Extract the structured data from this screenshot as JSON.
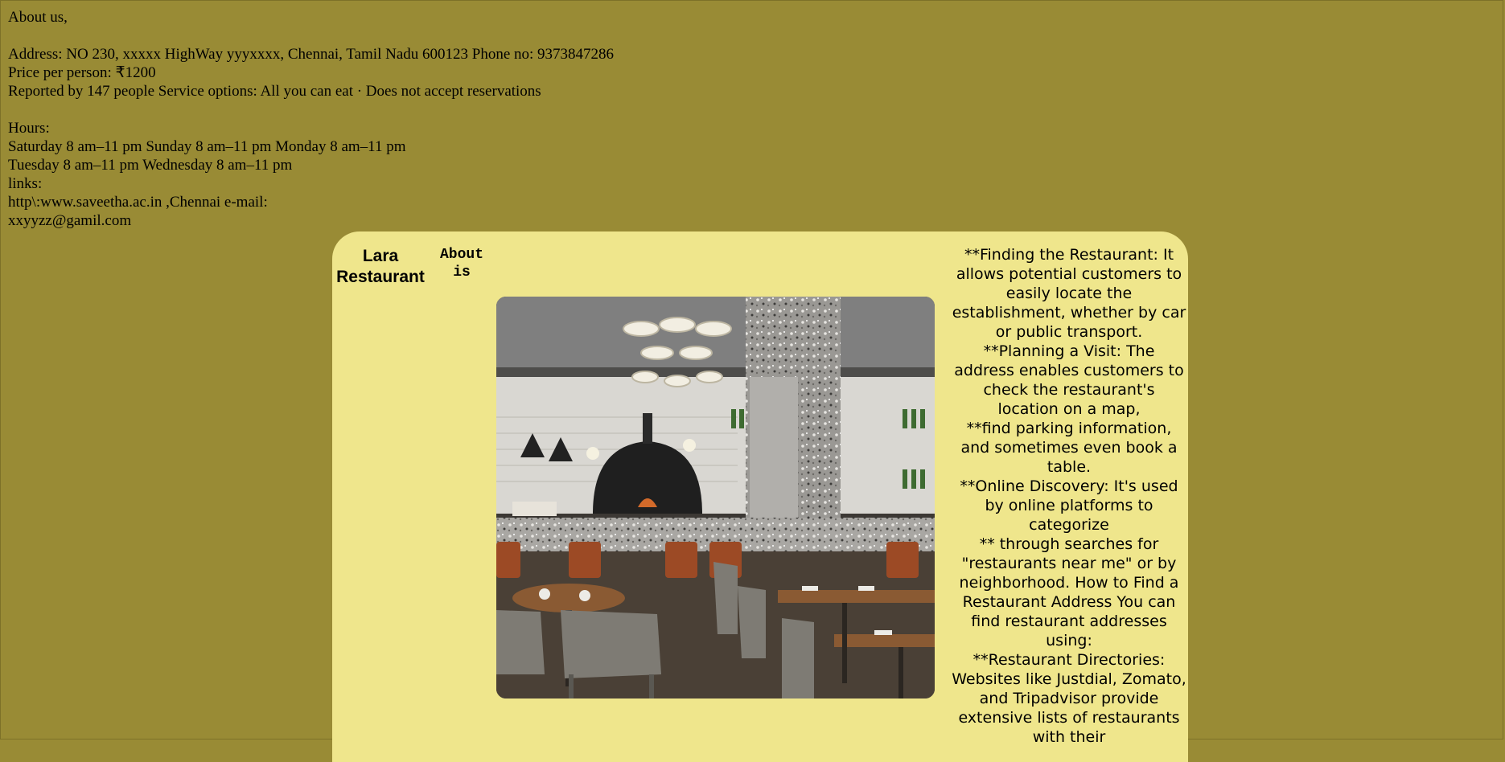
{
  "about": {
    "heading": "About us,",
    "address_line": "Address: NO 230, xxxxx HighWay yyyxxxx, Chennai, Tamil Nadu 600123 Phone no: 9373847286",
    "price_line": "Price per person: ₹1200",
    "service_line": "Reported by 147 people Service options: All you can eat · Does not accept reservations",
    "hours_label": "Hours:",
    "hours_line_1": "Saturday 8 am–11 pm Sunday 8 am–11 pm Monday 8 am–11 pm",
    "hours_line_2": "Tuesday 8 am–11 pm Wednesday 8 am–11 pm",
    "links_label": "links:",
    "links_line": "http\\:www.saveetha.ac.in ,Chennai e-mail:",
    "email": "xxyyzz@gamil.com"
  },
  "panel": {
    "brand_line_1": "Lara",
    "brand_line_2": "Restaurant",
    "about_line_1": "About",
    "about_line_2": "is",
    "photo_icon": "restaurant-interior-photo",
    "description": [
      "**Finding the Restaurant: It allows potential customers to easily locate the establishment, whether by car or public transport.",
      "**Planning a Visit: The address enables customers to check the restaurant's location on a map,",
      "**find parking information, and sometimes even book a table.",
      "**Online Discovery: It's used by online platforms to categorize",
      "** through searches for \"restaurants near me\" or by neighborhood. How to Find a Restaurant Address You can find restaurant addresses using:",
      "**Restaurant Directories: Websites like Justdial, Zomato, and Tripadvisor provide extensive lists of restaurants with their"
    ]
  },
  "colors": {
    "page_bg": "#998b35",
    "panel_bg": "#efe68c"
  }
}
